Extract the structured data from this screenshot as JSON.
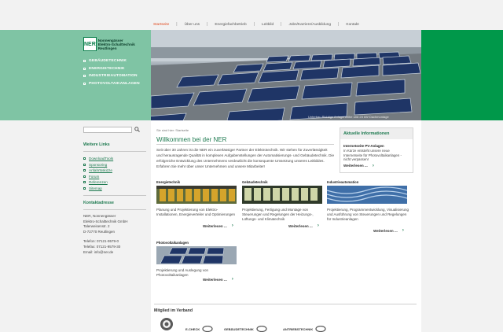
{
  "top_nav": {
    "items": [
      {
        "label": "Startseite",
        "active": true
      },
      {
        "label": "Über uns",
        "active": false
      },
      {
        "label": "Energiefachbetrieb",
        "active": false
      },
      {
        "label": "Leitbild",
        "active": false
      },
      {
        "label": "Jobs/Karriere/Ausbildung",
        "active": false
      },
      {
        "label": "Kontakt",
        "active": false
      }
    ],
    "separator": "|"
  },
  "logo": {
    "mark": "NER",
    "lines": [
      "Nonnengässer",
      "Elektro-Schalttechnik",
      "Reutlingen"
    ]
  },
  "main_menu": [
    "GEBÄUDETECHNIK",
    "ENERGIETECHNIK",
    "INDUSTRIEAUTOMATION",
    "PHOTOVOLTAIKANLAGEN"
  ],
  "hero": {
    "caption": "Unterbau Richtige Anlagenreihe und 23 kW Dachmontage"
  },
  "sidebar": {
    "search_placeholder": "",
    "links_heading": "Weitere Links",
    "links": [
      "DownloadTools",
      "Sponsoring",
      "Anfahrtsskizze",
      "Forum",
      "Referenzen",
      "Sitemap"
    ],
    "contact_heading": "Kontaktadresse",
    "address": [
      "NER, Nonnengässer",
      "Elektro-Schalttechnik GmbH",
      "Talerweisenstr. 2",
      "D-72770 Reutlingen"
    ],
    "phone": [
      "Telefon: 07121-9579-0",
      "Telefax: 07121-9579-30",
      "Email: info@ner.de"
    ]
  },
  "breadcrumb": "Sie sind hier: Startseite",
  "page_title": "Willkommen bei der NER",
  "intro_text": "Seit über 30 Jahren ist die NER ein zuverlässiger Partner der Elektrotechnik. Wir stehen für Zuverlässigkeit und herausragende Qualität in komplexen Aufgabenstellungen der Automatisierungs- und Gebäudetechnik. Die erfolgreiche Entwicklung des Unternehmens verdeutlicht die konsequente Umsetzung unseres Leitbildes. Erfahren Sie mehr über unser Unternehmen und unsere Mitarbeiter!",
  "info_box": {
    "heading": "Aktuelle Informationen",
    "subheading": "Internetseite PV-Anlagen",
    "text": "In Kürze entsteht unsere neue Internetseite für Photovoltaikanlagen - nicht verpassen!",
    "more": "Weiterlesen ..."
  },
  "teasers": [
    {
      "title": "Energietechnik",
      "text": "Planung und Projektierung von Elektro-Installationen, Energieverteiler und Optimierungen",
      "more": "Weiterlesen ..."
    },
    {
      "title": "Gebäudetechnik",
      "text": "Projektierung, Fertigung und Montage von Steuerungen und Regelungen der Heizungs-, Lüftungs- und Klimatechnik",
      "more": "Weiterlesen ..."
    },
    {
      "title": "Industrieautomation",
      "text": "Projektierung, Programmentwicklung, Visualisierung und Ausführung von Steuerungen und Regelungen für Industrieanlagen",
      "more": "Weiterlesen ..."
    },
    {
      "title": "Photovoltaikanlagen",
      "text": "Projektierung und Auslegung von Photovoltaikanlagen",
      "more": "Weiterlesen ..."
    }
  ],
  "verband": {
    "heading": "Mitglied im Verband",
    "badges": [
      "E-CHECK",
      "GEBÄUDETECHNIK",
      "ANTRIEBSTECHNIK"
    ]
  },
  "colors": {
    "accent_green": "#1e7a50",
    "band_light": "#7fc4a4",
    "band_dark": "#00984a",
    "active_nav": "#e0491e"
  },
  "icons": {
    "search": "search-icon",
    "arrow": "arrow-right-icon",
    "bullet": "square-bullet-icon"
  }
}
